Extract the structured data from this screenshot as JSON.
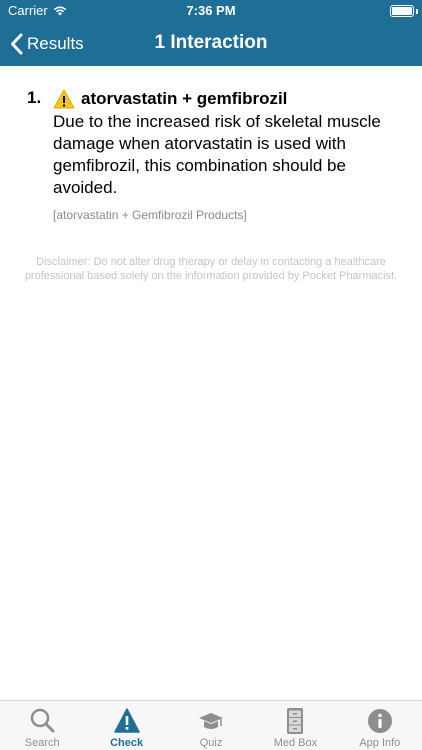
{
  "status_bar": {
    "carrier": "Carrier",
    "time": "7:36 PM"
  },
  "nav": {
    "back_label": "Results",
    "title": "1 Interaction"
  },
  "interactions": [
    {
      "number": "1.",
      "title": "atorvastatin + gemfibrozil",
      "description": "Due to the increased risk of skeletal muscle damage when atorvastatin is used with gemfibrozil, this combination should be avoided.",
      "source": "[atorvastatin + Gemfibrozil Products]",
      "warning_icon": "warning-icon"
    }
  ],
  "disclaimer": "Disclaimer: Do not alter drug therapy or delay in contacting a healthcare professional based solely on the information provided by Pocket Pharmacist.",
  "tabs": [
    {
      "label": "Search",
      "icon": "magnifier-icon",
      "active": false
    },
    {
      "label": "Check",
      "icon": "warning-triangle-icon",
      "active": true
    },
    {
      "label": "Quiz",
      "icon": "graduation-cap-icon",
      "active": false
    },
    {
      "label": "Med Box",
      "icon": "cabinet-icon",
      "active": false
    },
    {
      "label": "App Info",
      "icon": "info-icon",
      "active": false
    }
  ],
  "colors": {
    "header": "#1f6e96",
    "tab_active": "#1f6e96",
    "tab_inactive": "#8e8e8e",
    "warning": "#f5c518"
  }
}
